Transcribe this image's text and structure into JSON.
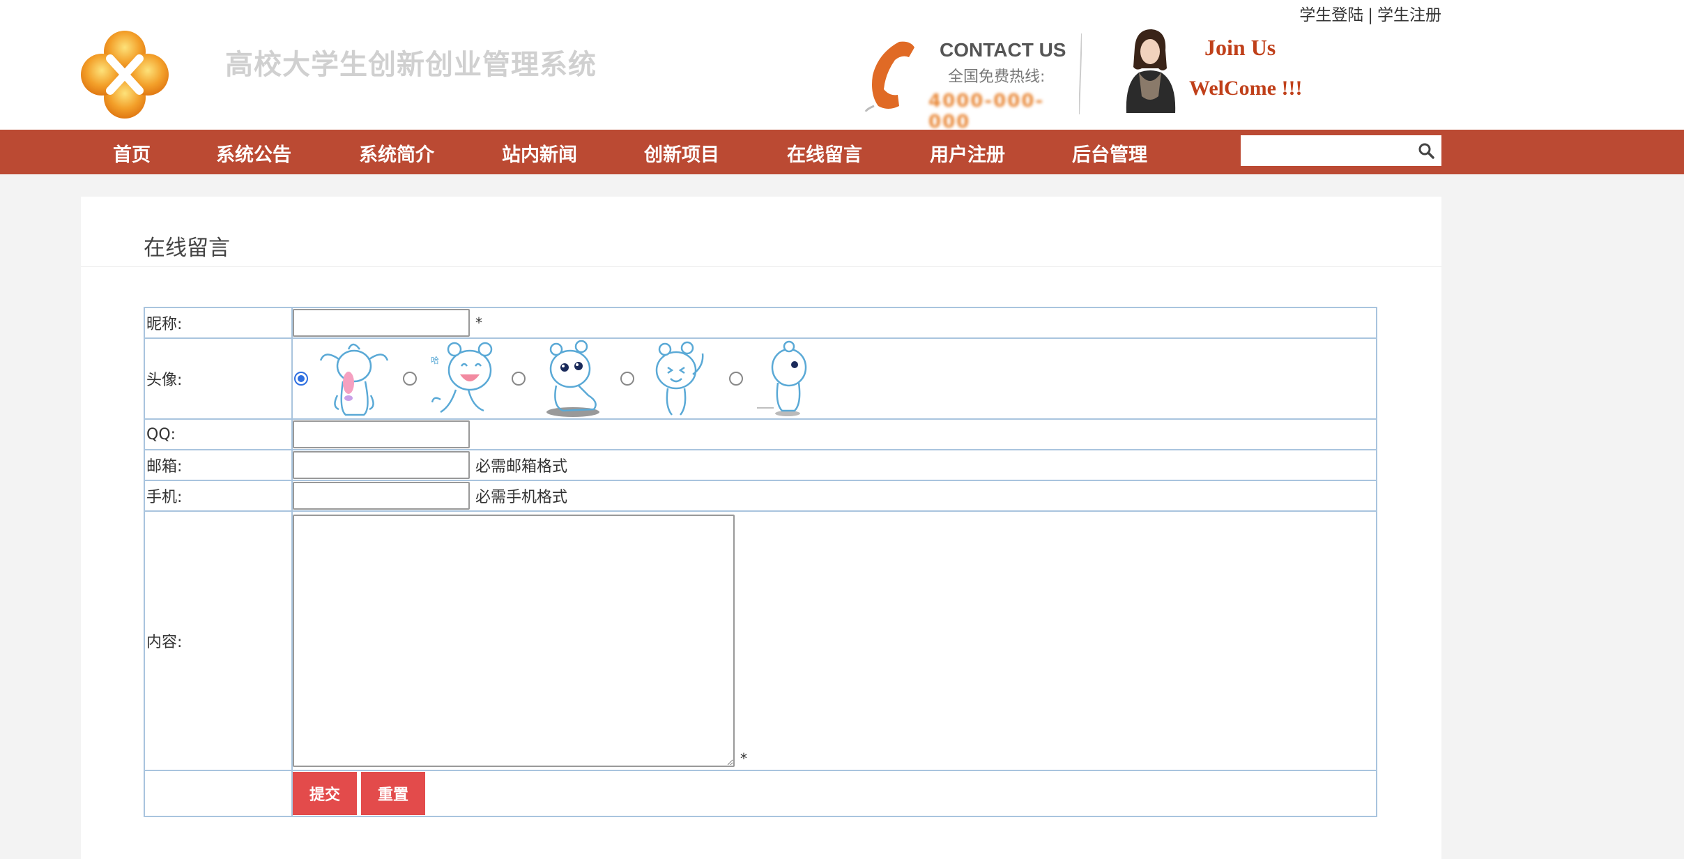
{
  "header": {
    "top_links": {
      "login": "学生登陆",
      "separator": "|",
      "register": "学生注册"
    },
    "site_title": "高校大学生创新创业管理系统",
    "contact": {
      "title": "CONTACT US",
      "subtitle": "全国免费热线:",
      "number": "4000-000-000"
    },
    "join_us": "Join Us",
    "welcome": "WelCome !!!"
  },
  "nav": {
    "items": [
      "首页",
      "系统公告",
      "系统简介",
      "站内新闻",
      "创新项目",
      "在线留言",
      "用户注册",
      "后台管理"
    ],
    "search_value": ""
  },
  "panel": {
    "title": "在线留言",
    "form": {
      "nickname_label": "昵称:",
      "nickname_required": "*",
      "avatar_label": "头像:",
      "avatar_selected_index": 0,
      "qq_label": "QQ:",
      "email_label": "邮箱:",
      "email_hint": "必需邮箱格式",
      "phone_label": "手机:",
      "phone_hint": "必需手机格式",
      "content_label": "内容:",
      "content_required": "*",
      "submit_label": "提交",
      "reset_label": "重置"
    }
  },
  "colors": {
    "nav_bg": "#bb4a33",
    "button_bg": "#e34b4b",
    "table_border": "#a9c4de",
    "accent": "#c0401a"
  }
}
